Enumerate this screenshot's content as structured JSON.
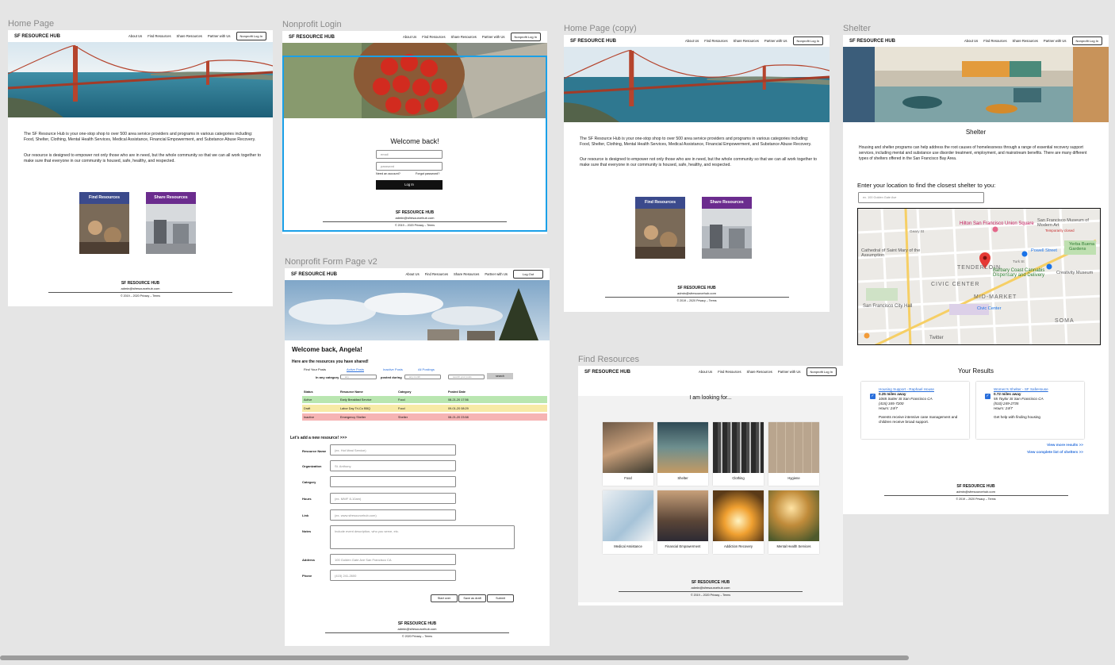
{
  "brand": "SF RESOURCE HUB",
  "nav": {
    "about": "About Us",
    "find": "Find Resources",
    "share": "Share Resources",
    "partner": "Partner with Us",
    "login": "Nonprofit Log In",
    "logout": "Log Out"
  },
  "footer": {
    "title": "SF RESOURCE HUB",
    "email": "admin@sfresourcehub.com",
    "copy": "© 2019 – 2020   Privacy – Terms",
    "copy2": "© 2020        Privacy – Terms"
  },
  "frames": {
    "home": {
      "label": "Home Page"
    },
    "login": {
      "label": "Nonprofit Login"
    },
    "homecopy": {
      "label": "Home Page (copy)"
    },
    "shelter": {
      "label": "Shelter"
    },
    "form": {
      "label": "Nonprofit Form Page v2"
    },
    "find": {
      "label": "Find Resources"
    }
  },
  "home": {
    "intro": "The SF Resource Hub is your one-stop shop to over 500 area service providers and programs in various categories including: Food, Shelter, Clothing, Mental Health Services, Medical Assistance, Financial Empowerment, and Substance Abuse Recovery.",
    "mission": "Our resource is designed to empower not only those who are in need, but the whole community so that we can all work together to make sure that everyone in our community is housed, safe, healthy, and respected.",
    "find_card": "Find Resources",
    "share_card": "Share Resources"
  },
  "login": {
    "title": "Welcome back!",
    "email_ph": "email",
    "password_ph": "password",
    "need_account": "Need an account?",
    "forgot": "Forgot password?",
    "button": "Log In"
  },
  "form": {
    "welcome": "Welcome back, Angela!",
    "shared_heading": "Here are the resources you have shared!",
    "find_posts": "Find Your Posts",
    "tabs": [
      "Active Posts",
      "Inactive Posts",
      "All Postings"
    ],
    "in_any_category": "In any category",
    "posted_during": "posted during",
    "cat_ph": "any",
    "date_ph": "any month",
    "search_ph": "search your posts",
    "search_btn": "search",
    "columns": [
      "Status",
      "Resource Name",
      "Category",
      "Posted Date"
    ],
    "rows": [
      {
        "status": "Active",
        "name": "Early Breakfast Service",
        "category": "Food",
        "date": "08-21-20 17:56",
        "color": "#b9e6b0"
      },
      {
        "status": "Draft",
        "name": "Labor Day Tri-Co BBQ",
        "category": "Food",
        "date": "09-01-20 08:29",
        "color": "#f7eaa6"
      },
      {
        "status": "Inactive",
        "name": "Emergency Shelter",
        "category": "Shelter",
        "date": "08-21-20 23:58",
        "color": "#f6b4b4"
      }
    ],
    "add_heading": "Let's add a new resource! >>>",
    "fields": [
      {
        "label": "Resource Name",
        "ph": "(ex. Hot Meal Service)"
      },
      {
        "label": "Organization",
        "ph": "St. Anthony"
      },
      {
        "label": "Category",
        "ph": ""
      },
      {
        "label": "Hours",
        "ph": "(ex. MWF 8-10am)"
      },
      {
        "label": "Link",
        "ph": "(ex. www.sfresourcehub.com)"
      },
      {
        "label": "Notes",
        "ph": "Include event description, who you serve, etc."
      },
      {
        "label": "Address",
        "ph": "100 Golden Gate Ave San Francisco CA"
      },
      {
        "label": "Phone",
        "ph": "(415) 241-2600"
      }
    ],
    "buttons": [
      "Start over",
      "Save as draft",
      "Submit"
    ]
  },
  "find": {
    "heading": "I am looking for...",
    "categories": [
      "Food",
      "Shelter",
      "Clothing",
      "Hygiene",
      "Medical Assistance",
      "Financial Empowerment",
      "Addiction Recovery",
      "Mental Health Services"
    ]
  },
  "shelter": {
    "title": "Shelter",
    "desc": "Housing and shelter programs can help address the root causes of homelessness through a range of essential recovery support services, including mental and substance use disorder treatment, employment, and mainstream benefits. There are many different types of shelters offered in the San Francisco Bay Area.",
    "location_prompt": "Enter your location to find the closest shelter to you:",
    "location_ph": "ex. 100 Golden Gate Ave",
    "results_title": "Your Results",
    "map_labels": [
      "Hilton San Francisco Union Square",
      "San Francisco Museum of Modern Art",
      "Temporarily closed",
      "Yerba Buena Gardens",
      "Cathedral of Saint Mary of the Assumption",
      "TENDERLOIN",
      "Powell Street",
      "Creativity Museum",
      "Barbary Coast Cannabis Dispensary and Delivery",
      "CIVIC CENTER",
      "San Francisco City Hall",
      "MID-MARKET",
      "Civic Center",
      "SOMA",
      "Twitter",
      "Geary St",
      "Turk St"
    ],
    "results": [
      {
        "name": "Housing Support - Raphael House",
        "distance": "0.25 miles away",
        "address": "1065 Sutter St San Francisco CA",
        "phone": "(415) 345-7200",
        "hours": "Hours: 24/7",
        "note": "Parents receive intensive case management and children receive broad support."
      },
      {
        "name": "Women's Shelter - SF SafeHouse",
        "distance": "0.72 miles away",
        "address": "55 Taylor St San Francisco CA",
        "phone": "(510) 249-2735",
        "hours": "Hours: 24/7",
        "note": "Get help with finding housing"
      }
    ],
    "more_results": "View more results >>",
    "complete_list": "View complete list of shelters >>"
  },
  "colors": {
    "find_card": "#3b4a8c",
    "share_card": "#6b2c8e",
    "selection": "#1aa0e8",
    "link": "#2a6fdb",
    "bg": "#e5e5e5"
  }
}
